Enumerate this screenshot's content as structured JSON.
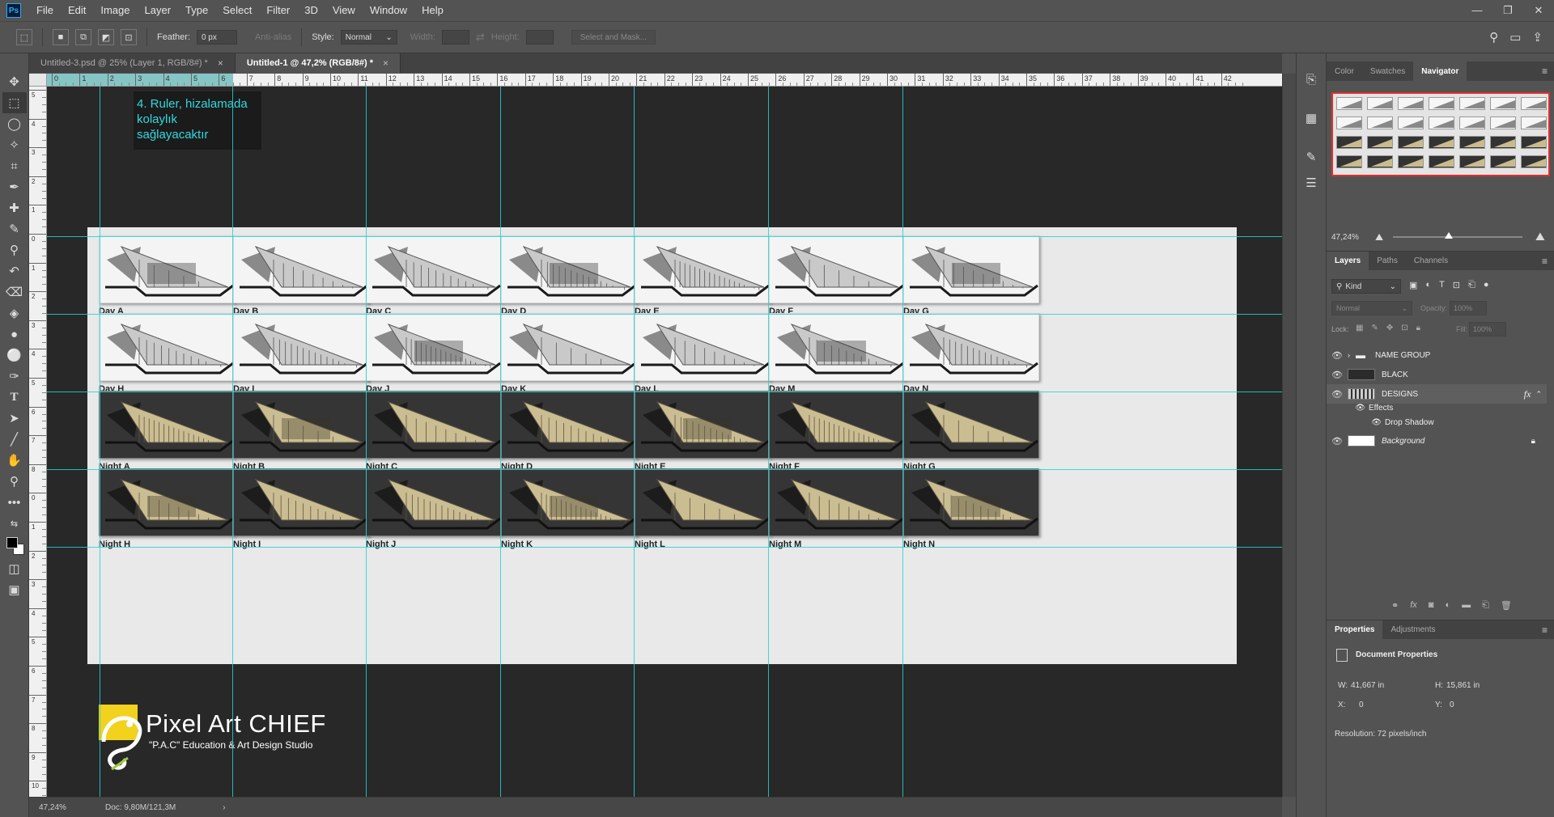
{
  "app": {
    "logo": "Ps",
    "menu": [
      "File",
      "Edit",
      "Image",
      "Layer",
      "Type",
      "Select",
      "Filter",
      "3D",
      "View",
      "Window",
      "Help"
    ],
    "window_controls": [
      "—",
      "❐",
      "✕"
    ]
  },
  "options": {
    "feather_label": "Feather:",
    "feather_value": "0 px",
    "antialias_label": "Anti-alias",
    "style_label": "Style:",
    "style_value": "Normal",
    "width_label": "Width:",
    "height_label": "Height:",
    "select_mask": "Select and Mask..."
  },
  "tabs": [
    {
      "label": "Untitled-3.psd @ 25% (Layer 1, RGB/8#) *",
      "close": "×"
    },
    {
      "label": "Untitled-1 @ 47,2% (RGB/8#) *",
      "close": "×"
    }
  ],
  "ruler": {
    "h_ticks": [
      "0",
      "1",
      "2",
      "3",
      "4",
      "5",
      "6",
      "7",
      "8",
      "9",
      "10",
      "11",
      "12",
      "13",
      "14",
      "15",
      "16",
      "17",
      "18",
      "19",
      "20",
      "21",
      "22",
      "23",
      "24",
      "25",
      "26",
      "27",
      "28",
      "29",
      "30",
      "31",
      "32",
      "33",
      "34",
      "35",
      "36",
      "37",
      "38",
      "39",
      "40",
      "41",
      "42"
    ],
    "v_ticks": [
      "5",
      "4",
      "3",
      "2",
      "1",
      "0",
      "1",
      "2",
      "3",
      "4",
      "5",
      "6",
      "7",
      "8",
      "0",
      "1",
      "2",
      "3",
      "4",
      "5",
      "6",
      "7",
      "8",
      "9",
      "10"
    ]
  },
  "annotation": "4. Ruler, hizalamada\n kolaylık\n sağlayacaktır",
  "grid": {
    "rows": [
      {
        "theme": "day",
        "labels": [
          "Day A",
          "Day B",
          "Day C",
          "Day D",
          "Day E",
          "Day F",
          "Day G"
        ]
      },
      {
        "theme": "day",
        "labels": [
          "Day H",
          "Day I",
          "Day J",
          "Day K",
          "Day L",
          "Day M",
          "Day N"
        ]
      },
      {
        "theme": "night",
        "labels": [
          "Night A",
          "Night B",
          "Night C",
          "Night D",
          "Night E",
          "Night F",
          "Night G"
        ]
      },
      {
        "theme": "night",
        "labels": [
          "Night H",
          "Night I",
          "Night J",
          "Night K",
          "Night L",
          "Night M",
          "Night N"
        ]
      }
    ]
  },
  "logo": {
    "title": "Pixel Art CHIEF",
    "subtitle": "\"P.A.C\" Education & Art Design Studio"
  },
  "status": {
    "zoom": "47,24%",
    "doc": "Doc: 9,80M/121,3M",
    "arrow": "›"
  },
  "panels": {
    "top_tabs": [
      "Color",
      "Swatches",
      "Navigator"
    ],
    "nav_zoom": "47,24%",
    "layer_tabs": [
      "Layers",
      "Paths",
      "Channels"
    ],
    "kind": "Kind",
    "blend": "Normal",
    "opacity_label": "Opacity:",
    "opacity": "100%",
    "lock_label": "Lock:",
    "fill_label": "Fill:",
    "fill": "100%",
    "layers": [
      {
        "name": "NAME GROUP",
        "type": "group"
      },
      {
        "name": "BLACK",
        "type": "layer"
      },
      {
        "name": "DESIGNS",
        "type": "layer",
        "fx": "fx"
      },
      {
        "name": "Effects",
        "type": "effects"
      },
      {
        "name": "Drop Shadow",
        "type": "effect"
      },
      {
        "name": "Background",
        "type": "background"
      }
    ],
    "prop_tabs": [
      "Properties",
      "Adjustments"
    ],
    "doc_props": "Document Properties",
    "w_label": "W:",
    "w": "41,667 in",
    "h_label": "H:",
    "h": "15,861 in",
    "x_label": "X:",
    "x": "0",
    "y_label": "Y:",
    "y": "0",
    "resolution": "Resolution: 72 pixels/inch"
  },
  "colors": {
    "guide": "#25d0d8",
    "annotation": "#31d9de",
    "highlight": "#e03030"
  }
}
